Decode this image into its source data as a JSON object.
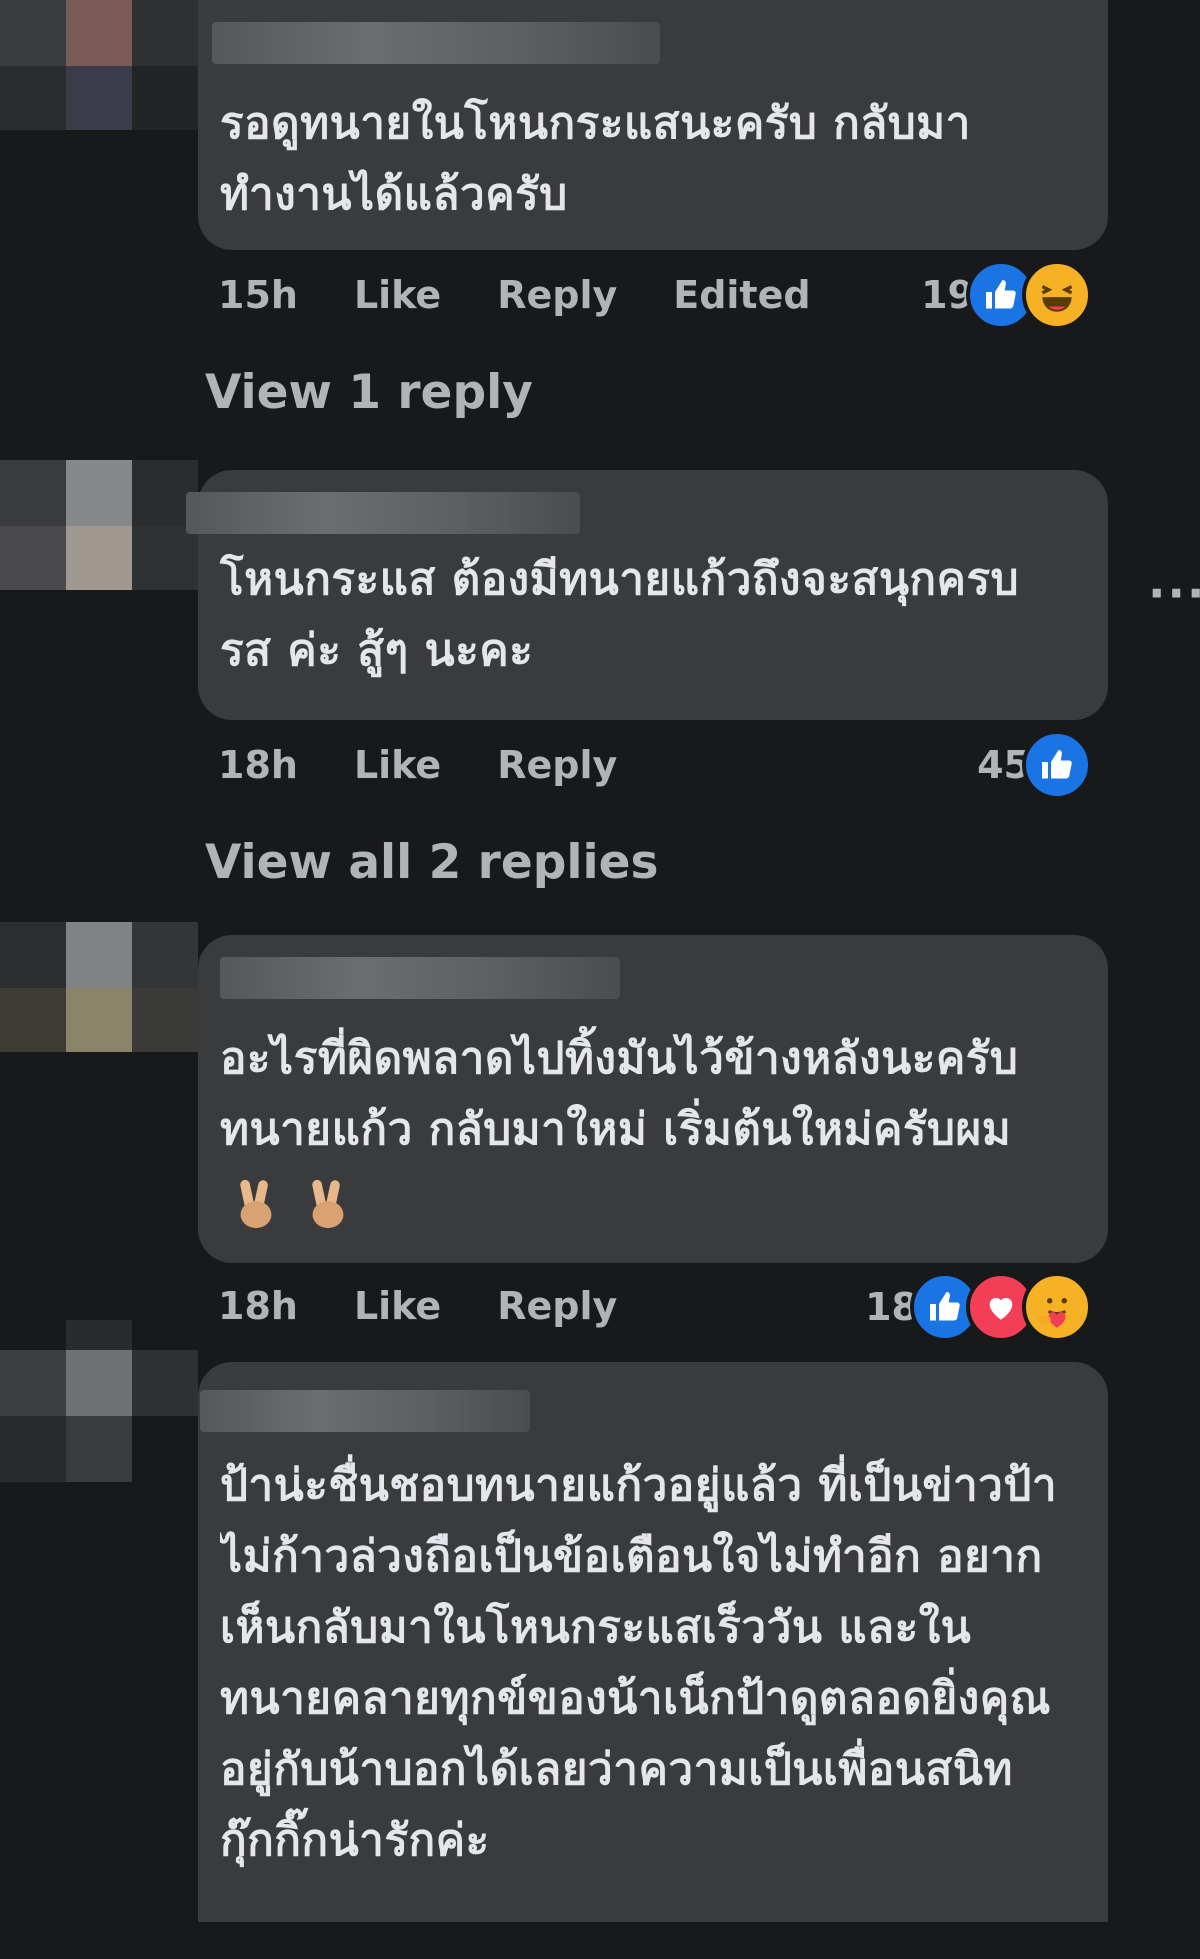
{
  "comments": [
    {
      "text": "รอดูทนายในโหนกระแสนะครับ กลับมาทำงานได้แล้วครับ",
      "time": "15h",
      "like_label": "Like",
      "reply_label": "Reply",
      "edited_label": "Edited",
      "reaction_count": "19",
      "reactions": [
        "like-icon",
        "haha-icon"
      ],
      "view_replies": "View 1 reply"
    },
    {
      "text": "โหนกระแส ต้องมีทนายแก้วถึงจะสนุกครบรส ค่ะ สู้ๆ นะคะ",
      "time": "18h",
      "like_label": "Like",
      "reply_label": "Reply",
      "reaction_count": "45",
      "reactions": [
        "like-icon"
      ],
      "view_replies": "View all 2 replies",
      "more_options": "···"
    },
    {
      "text": "อะไรที่ผิดพลาดไปทิ้งมันไว้ข้างหลังนะครับทนายแก้ว กลับมาใหม่ เริ่มต้นใหม่ครับผม",
      "emoji": [
        "victory-hand-icon",
        "victory-hand-icon"
      ],
      "time": "18h",
      "like_label": "Like",
      "reply_label": "Reply",
      "reaction_count": "18",
      "reactions": [
        "like-icon",
        "love-icon",
        "care-icon"
      ]
    },
    {
      "text": "ป้าน่ะชื่นชอบทนายแก้วอยู่แล้ว ที่เป็นข่าวป้าไม่ก้าวล่วงถือเป็นข้อเตือนใจไม่ทำอีก อยากเห็นกลับมาในโหนกระแสเร็ววัน และในทนายคลายทุกข์ของน้าเน็กป้าดูตลอดยิ่งคุณอยู่กับน้าบอกได้เลยว่าความเป็นเพื่อนสนิทกุ๊กกิ๊กน่ารักค่ะ"
    }
  ],
  "colors": {
    "background": "#18191a",
    "bubble": "#3a3b3c",
    "text": "#e4e6eb",
    "secondary": "#b0b3b8",
    "like_blue": "#1b74e4"
  }
}
